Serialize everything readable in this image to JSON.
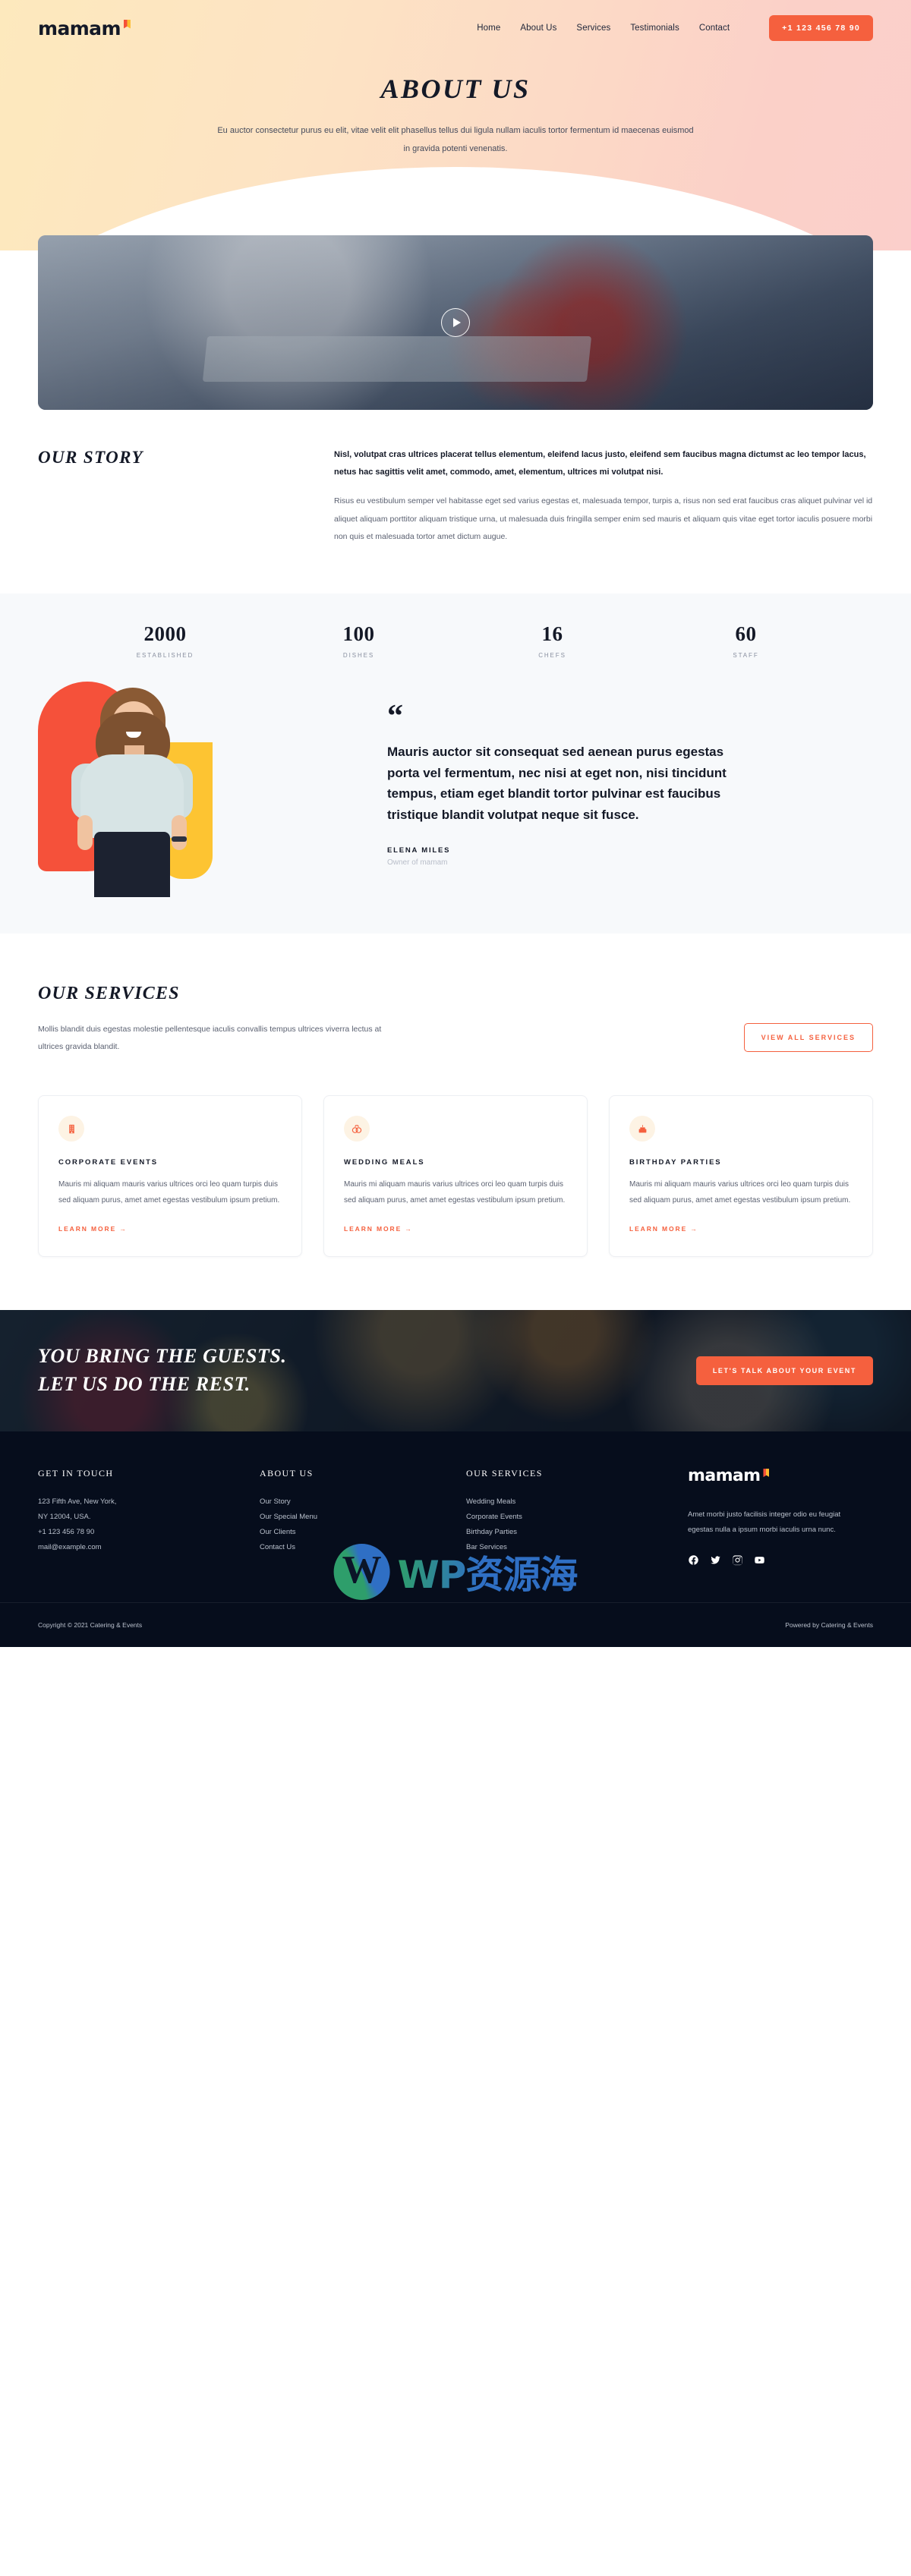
{
  "header": {
    "logo_text": "mamam",
    "nav": [
      {
        "label": "Home"
      },
      {
        "label": "About Us"
      },
      {
        "label": "Services"
      },
      {
        "label": "Testimonials"
      },
      {
        "label": "Contact"
      }
    ],
    "phone_button": "+1 123 456 78 90"
  },
  "hero": {
    "title": "ABOUT US",
    "subtitle": "Eu auctor consectetur purus eu elit, vitae velit elit phasellus tellus dui ligula nullam iaculis tortor fermentum id maecenas euismod in gravida potenti venenatis."
  },
  "video": {
    "play_label": "play-video"
  },
  "story": {
    "title": "OUR STORY",
    "lead": "Nisl, volutpat cras ultrices placerat tellus elementum, eleifend lacus justo, eleifend sem faucibus magna dictumst ac leo tempor lacus, netus hac sagittis velit amet, commodo, amet, elementum, ultrices mi volutpat nisi.",
    "paragraph": "Risus eu vestibulum semper vel habitasse eget sed varius egestas et, malesuada tempor, turpis a, risus non sed erat faucibus cras aliquet pulvinar vel id aliquet aliquam porttitor aliquam tristique urna, ut malesuada duis fringilla semper enim sed mauris et aliquam quis vitae eget tortor iaculis posuere morbi non quis et malesuada tortor amet dictum augue."
  },
  "stats": [
    {
      "number": "2000",
      "label": "ESTABLISHED"
    },
    {
      "number": "100",
      "label": "DISHES"
    },
    {
      "number": "16",
      "label": "CHEFS"
    },
    {
      "number": "60",
      "label": "STAFF"
    }
  ],
  "testimonial": {
    "quote_mark": "“",
    "text": "Mauris auctor sit consequat sed aenean purus egestas porta vel fermentum, nec nisi at eget non, nisi tincidunt tempus, etiam eget blandit tortor pulvinar est faucibus tristique blandit volutpat neque sit fusce.",
    "name": "ELENA MILES",
    "role": "Owner of mamam"
  },
  "services": {
    "title": "OUR SERVICES",
    "subtitle": "Mollis blandit duis egestas molestie pellentesque iaculis convallis tempus ultrices viverra lectus at ultrices gravida blandit.",
    "view_all_label": "VIEW ALL SERVICES",
    "cards": [
      {
        "icon": "building-icon",
        "title": "CORPORATE EVENTS",
        "text": "Mauris mi aliquam mauris varius ultrices orci leo quam turpis duis sed aliquam purus, amet amet egestas vestibulum ipsum pretium.",
        "link": "LEARN MORE →"
      },
      {
        "icon": "rings-icon",
        "title": "WEDDING MEALS",
        "text": "Mauris mi aliquam mauris varius ultrices orci leo quam turpis duis sed aliquam purus, amet amet egestas vestibulum ipsum pretium.",
        "link": "LEARN MORE →"
      },
      {
        "icon": "cake-icon",
        "title": "BIRTHDAY PARTIES",
        "text": "Mauris mi aliquam mauris varius ultrices orci leo quam turpis duis sed aliquam purus, amet amet egestas vestibulum ipsum pretium.",
        "link": "LEARN MORE →"
      }
    ]
  },
  "cta": {
    "line1": "YOU BRING THE GUESTS.",
    "line2": "LET US DO THE REST.",
    "button": "LET'S TALK ABOUT YOUR EVENT"
  },
  "footer": {
    "contact": {
      "heading": "GET IN TOUCH",
      "address_line1": "123 Fifth Ave, New York,",
      "address_line2": "NY 12004, USA.",
      "phone": "+1 123 456 78 90",
      "email": "mail@example.com"
    },
    "about": {
      "heading": "ABOUT US",
      "links": [
        "Our Story",
        "Our Special Menu",
        "Our Clients",
        "Contact Us"
      ]
    },
    "services": {
      "heading": "OUR SERVICES",
      "links": [
        "Wedding Meals",
        "Corporate Events",
        "Birthday Parties",
        "Bar Services"
      ]
    },
    "brand": {
      "logo_text": "mamam",
      "description": "Amet morbi justo facilisis integer odio eu feugiat egestas nulla a ipsum morbi iaculis urna nunc.",
      "socials": [
        "facebook-icon",
        "twitter-icon",
        "instagram-icon",
        "youtube-icon"
      ]
    },
    "copyright": "Copyright © 2021 Catering & Events",
    "powered_by": "Powered by Catering & Events"
  },
  "watermark": {
    "text": "WP资源海"
  },
  "colors": {
    "accent": "#f5603e",
    "dark": "#141927",
    "footer_bg": "#060d1c",
    "yellow": "#fdc432",
    "orange_blob": "#f5513a"
  }
}
